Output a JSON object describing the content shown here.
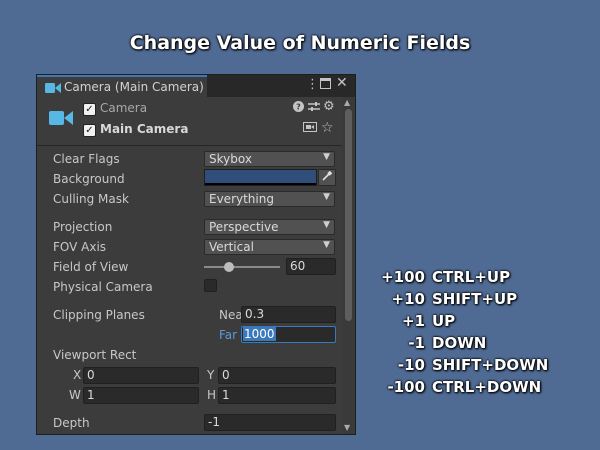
{
  "title": "Change Value of Numeric Fields",
  "window": {
    "tab_label": "Camera (Main Camera)",
    "menu_icon": "kebab-menu-icon",
    "maximize_icon": "maximize-icon",
    "close_icon": "close-icon"
  },
  "component": {
    "camera_label": "Camera",
    "object_label": "Main Camera",
    "camera_enabled": true,
    "object_active": true
  },
  "props": {
    "clear_flags": {
      "label": "Clear Flags",
      "value": "Skybox"
    },
    "background": {
      "label": "Background",
      "color": "#314e7a"
    },
    "culling_mask": {
      "label": "Culling Mask",
      "value": "Everything"
    },
    "projection": {
      "label": "Projection",
      "value": "Perspective"
    },
    "fov_axis": {
      "label": "FOV Axis",
      "value": "Vertical"
    },
    "field_of_view": {
      "label": "Field of View",
      "value": "60"
    },
    "physical_camera": {
      "label": "Physical Camera",
      "checked": false
    },
    "clipping_planes": {
      "label": "Clipping Planes",
      "near_label": "Near",
      "near": "0.3",
      "far_label": "Far",
      "far": "1000"
    },
    "viewport_rect": {
      "label": "Viewport Rect",
      "x_label": "X",
      "x": "0",
      "y_label": "Y",
      "y": "0",
      "w_label": "W",
      "w": "1",
      "h_label": "H",
      "h": "1"
    },
    "depth": {
      "label": "Depth",
      "value": "-1"
    }
  },
  "shortcuts": [
    {
      "amount": "+100",
      "keys": "CTRL+UP"
    },
    {
      "amount": "+10",
      "keys": "SHIFT+UP"
    },
    {
      "amount": "+1",
      "keys": "UP"
    },
    {
      "amount": "-1",
      "keys": "DOWN"
    },
    {
      "amount": "-10",
      "keys": "SHIFT+DOWN"
    },
    {
      "amount": "-100",
      "keys": "CTRL+DOWN"
    }
  ],
  "colors": {
    "background": "#4f6a93",
    "accent": "#3a79bb",
    "panel": "#3c3c3c",
    "camera_icon": "#57b8e6"
  }
}
